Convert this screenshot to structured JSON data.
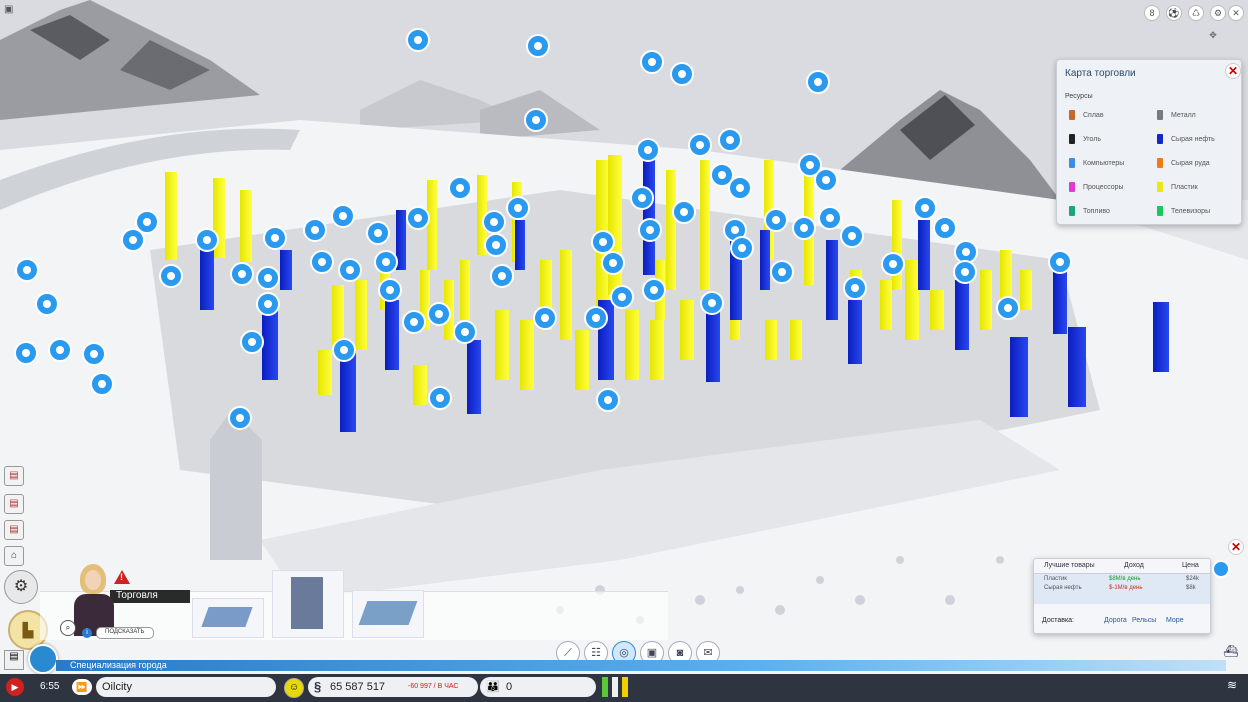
{
  "trade_map": {
    "title": "Карта торговли",
    "section": "Ресурсы",
    "items": [
      {
        "label": "Сплав",
        "color": "#c46a2a"
      },
      {
        "label": "Металл",
        "color": "#7a7a7a"
      },
      {
        "label": "Уголь",
        "color": "#222222"
      },
      {
        "label": "Сырая нефть",
        "color": "#1428c8"
      },
      {
        "label": "Компьютеры",
        "color": "#3a8ee6"
      },
      {
        "label": "Сырая руда",
        "color": "#f07a14"
      },
      {
        "label": "Процессоры",
        "color": "#e03ad0"
      },
      {
        "label": "Пластик",
        "color": "#f0e614"
      },
      {
        "label": "Топливо",
        "color": "#18a878"
      },
      {
        "label": "Телевизоры",
        "color": "#18c858"
      }
    ],
    "close": "✕"
  },
  "goods_panel": {
    "col_goods": "Лучшие товары",
    "col_income": "Доход",
    "col_price": "Цена",
    "rows": [
      {
        "name": "Пластик",
        "income": "$8M/в день",
        "price": "$24k"
      },
      {
        "name": "Сырая нефть",
        "income": "$-1M/в день",
        "price": "$8k"
      }
    ],
    "delivery_label": "Доставка:",
    "road": "Дорога",
    "rails": "Рельсы",
    "sea": "Море",
    "close": "✕"
  },
  "advisor": {
    "title": "Торговля",
    "hint": "ПОДСКАЗАТЬ",
    "info": "i",
    "alert": "!"
  },
  "bottom": {
    "specialization": "Специализация города",
    "time": "6:55",
    "city_name": "Oilcity",
    "money": "65 587 517",
    "per_hour": "-60 997 / В ЧАС",
    "population": "0",
    "money_symbol": "§"
  },
  "top_icons": [
    "8",
    "⚽",
    "♺",
    "⚙",
    "✕"
  ],
  "colors": {
    "yellow": "#f2f20a",
    "blue": "#1030d8",
    "pin": "#2a9af0"
  }
}
